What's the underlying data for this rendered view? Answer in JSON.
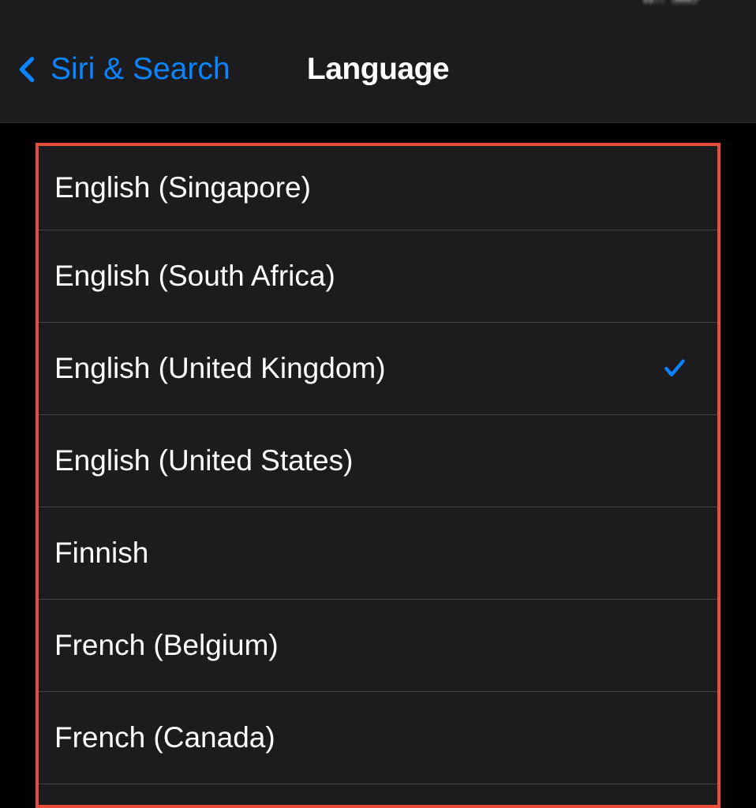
{
  "colors": {
    "accent": "#0a84ff",
    "highlight_border": "#e74c3c"
  },
  "nav": {
    "back_label": "Siri & Search",
    "title": "Language"
  },
  "languages": [
    {
      "label": "English (Singapore)",
      "selected": false
    },
    {
      "label": "English (South Africa)",
      "selected": false
    },
    {
      "label": "English (United Kingdom)",
      "selected": true
    },
    {
      "label": "English (United States)",
      "selected": false
    },
    {
      "label": "Finnish",
      "selected": false
    },
    {
      "label": "French (Belgium)",
      "selected": false
    },
    {
      "label": "French (Canada)",
      "selected": false
    }
  ]
}
